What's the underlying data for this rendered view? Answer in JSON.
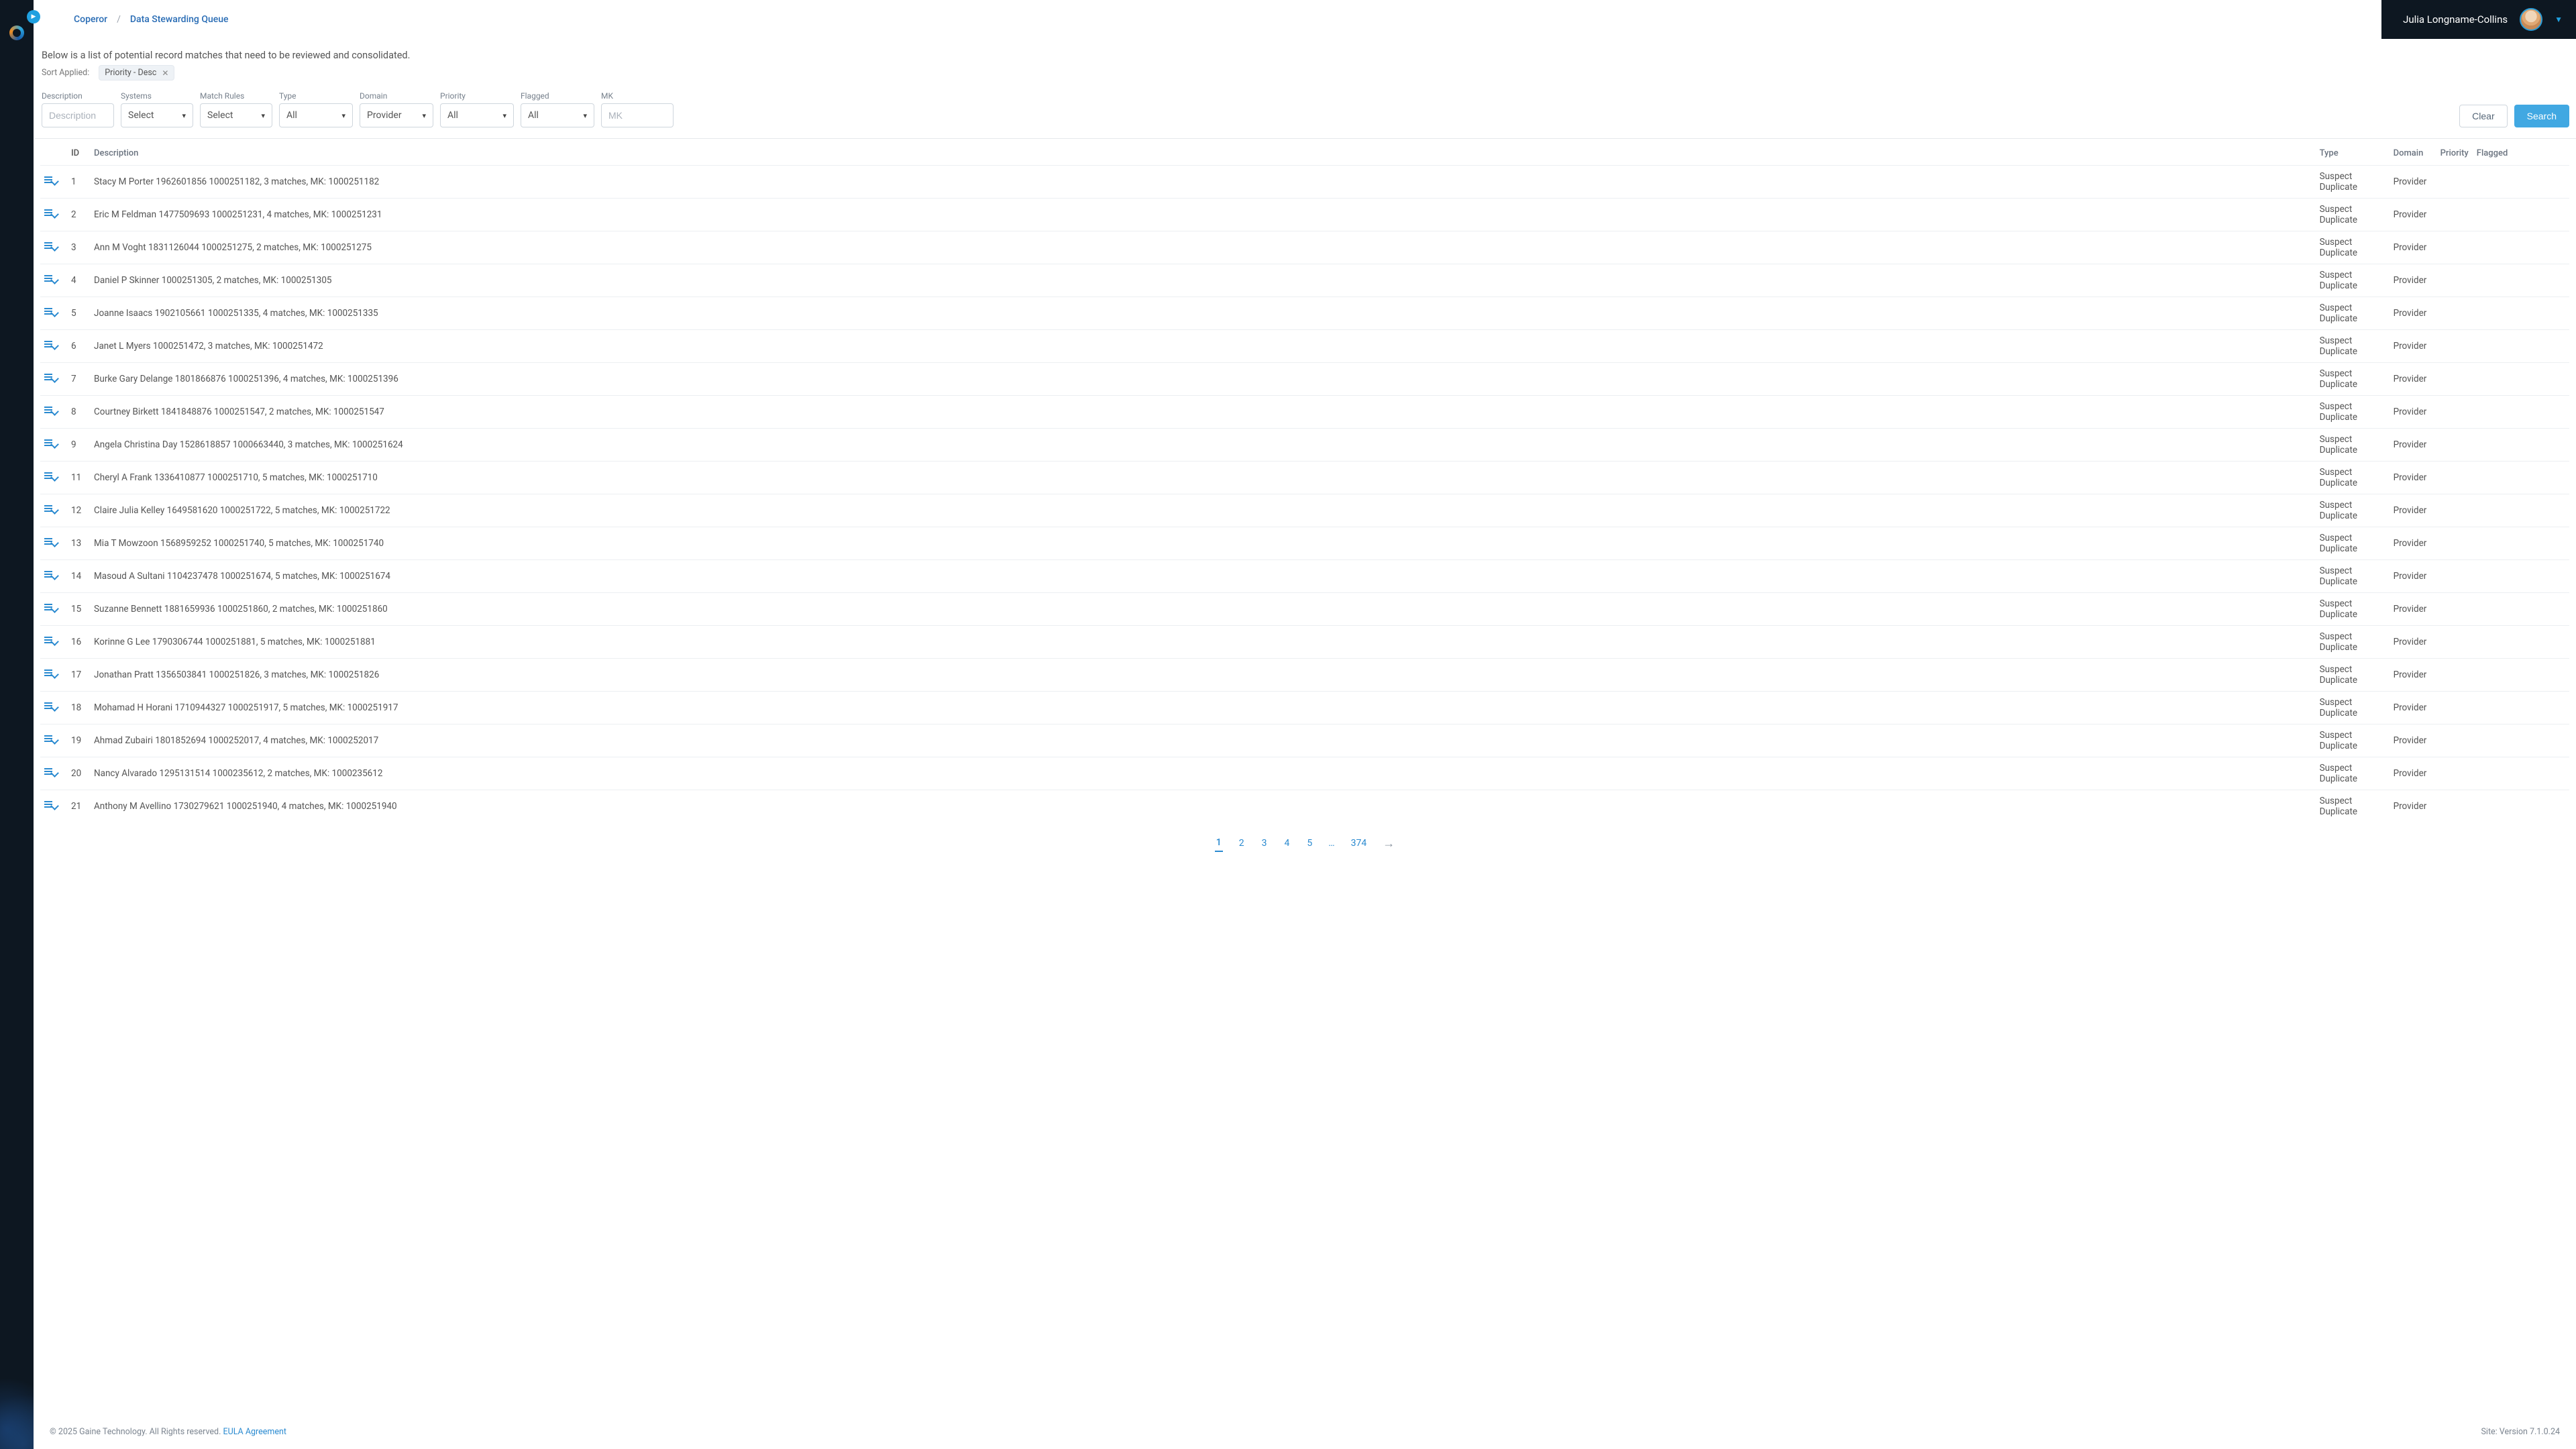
{
  "breadcrumbs": {
    "root": "Coperor",
    "page": "Data Stewarding Queue"
  },
  "user": {
    "name": "Julia Longname-Collins"
  },
  "intro": "Below is a list of potential record matches that need to be reviewed and consolidated.",
  "sort": {
    "label": "Sort Applied:",
    "chip": "Priority - Desc"
  },
  "filters": {
    "description": {
      "label": "Description",
      "placeholder": "Description"
    },
    "systems": {
      "label": "Systems",
      "value": "Select"
    },
    "matchRules": {
      "label": "Match Rules",
      "value": "Select"
    },
    "type": {
      "label": "Type",
      "value": "All"
    },
    "domain": {
      "label": "Domain",
      "value": "Provider"
    },
    "priority": {
      "label": "Priority",
      "value": "All"
    },
    "flagged": {
      "label": "Flagged",
      "value": "All"
    },
    "mk": {
      "label": "MK",
      "placeholder": "MK"
    }
  },
  "buttons": {
    "clear": "Clear",
    "search": "Search"
  },
  "columns": {
    "id": "ID",
    "description": "Description",
    "type": "Type",
    "domain": "Domain",
    "priority": "Priority",
    "flagged": "Flagged"
  },
  "rows": [
    {
      "id": "1",
      "description": "Stacy M Porter 1962601856 1000251182, 3 matches, MK: 1000251182",
      "type": "Suspect Duplicate",
      "domain": "Provider"
    },
    {
      "id": "2",
      "description": "Eric M Feldman 1477509693 1000251231, 4 matches, MK: 1000251231",
      "type": "Suspect Duplicate",
      "domain": "Provider"
    },
    {
      "id": "3",
      "description": "Ann M Voght 1831126044 1000251275, 2 matches, MK: 1000251275",
      "type": "Suspect Duplicate",
      "domain": "Provider"
    },
    {
      "id": "4",
      "description": "Daniel P Skinner 1000251305, 2 matches, MK: 1000251305",
      "type": "Suspect Duplicate",
      "domain": "Provider"
    },
    {
      "id": "5",
      "description": "Joanne Isaacs 1902105661 1000251335, 4 matches, MK: 1000251335",
      "type": "Suspect Duplicate",
      "domain": "Provider"
    },
    {
      "id": "6",
      "description": "Janet L Myers 1000251472, 3 matches, MK: 1000251472",
      "type": "Suspect Duplicate",
      "domain": "Provider"
    },
    {
      "id": "7",
      "description": "Burke Gary Delange 1801866876 1000251396, 4 matches, MK: 1000251396",
      "type": "Suspect Duplicate",
      "domain": "Provider"
    },
    {
      "id": "8",
      "description": "Courtney Birkett 1841848876 1000251547, 2 matches, MK: 1000251547",
      "type": "Suspect Duplicate",
      "domain": "Provider"
    },
    {
      "id": "9",
      "description": "Angela Christina Day 1528618857 1000663440, 3 matches, MK: 1000251624",
      "type": "Suspect Duplicate",
      "domain": "Provider"
    },
    {
      "id": "11",
      "description": "Cheryl A Frank 1336410877 1000251710, 5 matches, MK: 1000251710",
      "type": "Suspect Duplicate",
      "domain": "Provider"
    },
    {
      "id": "12",
      "description": "Claire Julia Kelley 1649581620 1000251722, 5 matches, MK: 1000251722",
      "type": "Suspect Duplicate",
      "domain": "Provider"
    },
    {
      "id": "13",
      "description": "Mia T Mowzoon 1568959252 1000251740, 5 matches, MK: 1000251740",
      "type": "Suspect Duplicate",
      "domain": "Provider"
    },
    {
      "id": "14",
      "description": "Masoud A Sultani 1104237478 1000251674, 5 matches, MK: 1000251674",
      "type": "Suspect Duplicate",
      "domain": "Provider"
    },
    {
      "id": "15",
      "description": "Suzanne Bennett 1881659936 1000251860, 2 matches, MK: 1000251860",
      "type": "Suspect Duplicate",
      "domain": "Provider"
    },
    {
      "id": "16",
      "description": "Korinne G Lee 1790306744 1000251881, 5 matches, MK: 1000251881",
      "type": "Suspect Duplicate",
      "domain": "Provider"
    },
    {
      "id": "17",
      "description": "Jonathan Pratt 1356503841 1000251826, 3 matches, MK: 1000251826",
      "type": "Suspect Duplicate",
      "domain": "Provider"
    },
    {
      "id": "18",
      "description": "Mohamad H Horani 1710944327 1000251917, 5 matches, MK: 1000251917",
      "type": "Suspect Duplicate",
      "domain": "Provider"
    },
    {
      "id": "19",
      "description": "Ahmad Zubairi 1801852694 1000252017, 4 matches, MK: 1000252017",
      "type": "Suspect Duplicate",
      "domain": "Provider"
    },
    {
      "id": "20",
      "description": "Nancy Alvarado 1295131514 1000235612, 2 matches, MK: 1000235612",
      "type": "Suspect Duplicate",
      "domain": "Provider"
    },
    {
      "id": "21",
      "description": "Anthony M Avellino 1730279621 1000251940, 4 matches, MK: 1000251940",
      "type": "Suspect Duplicate",
      "domain": "Provider"
    }
  ],
  "pagination": {
    "pages": [
      "1",
      "2",
      "3",
      "4",
      "5"
    ],
    "ellipsis": "…",
    "last": "374",
    "active": "1"
  },
  "footer": {
    "copyright": "© 2025 Gaine Technology. All Rights reserved. ",
    "eula": "EULA Agreement",
    "version": "Site: Version 7.1.0.24"
  }
}
